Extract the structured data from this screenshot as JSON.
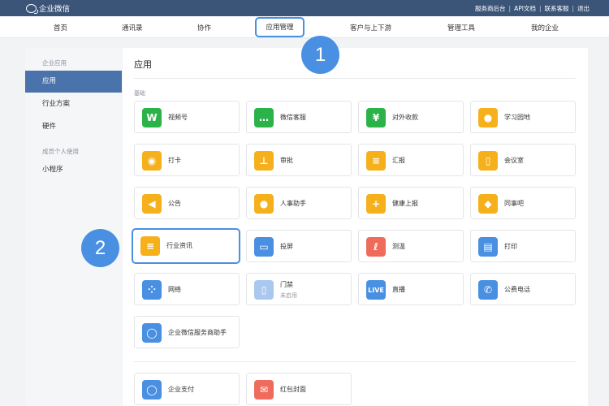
{
  "topbar": {
    "brand": "企业微信",
    "links": [
      "服务商后台",
      "API文档",
      "联系客服",
      "退出"
    ]
  },
  "nav": {
    "items": [
      "首页",
      "通讯录",
      "协作",
      "应用管理",
      "客户与上下游",
      "管理工具",
      "我的企业"
    ]
  },
  "sidebar": {
    "group1": "企业应用",
    "items1": [
      "应用",
      "行业方案",
      "硬件"
    ],
    "group2": "成员个人使用",
    "items2": [
      "小程序"
    ]
  },
  "main": {
    "title": "应用",
    "section": "基础",
    "apps": [
      {
        "label": "视频号",
        "color": "#2bb34a",
        "icon": "video-channel-icon"
      },
      {
        "label": "微信客服",
        "color": "#2bb34a",
        "icon": "wechat-service-icon"
      },
      {
        "label": "对外收款",
        "color": "#2bb34a",
        "icon": "payment-icon"
      },
      {
        "label": "学习园地",
        "color": "#f5b01b",
        "icon": "planet-icon"
      },
      {
        "label": "打卡",
        "color": "#f5b01b",
        "icon": "location-pin-icon"
      },
      {
        "label": "审批",
        "color": "#f5b01b",
        "icon": "stamp-icon"
      },
      {
        "label": "汇报",
        "color": "#f5b01b",
        "icon": "report-icon"
      },
      {
        "label": "会议室",
        "color": "#f5b01b",
        "icon": "door-icon"
      },
      {
        "label": "公告",
        "color": "#f5b01b",
        "icon": "megaphone-icon"
      },
      {
        "label": "人事助手",
        "color": "#f5b01b",
        "icon": "person-icon"
      },
      {
        "label": "健康上报",
        "color": "#f5b01b",
        "icon": "medical-kit-icon"
      },
      {
        "label": "同事吧",
        "color": "#f5b01b",
        "icon": "network-icon"
      },
      {
        "label": "行业资讯",
        "color": "#f5b01b",
        "icon": "news-icon"
      },
      {
        "label": "投屏",
        "color": "#4a90e2",
        "icon": "screen-cast-icon"
      },
      {
        "label": "测温",
        "color": "#ef6b5b",
        "icon": "thermometer-icon"
      },
      {
        "label": "打印",
        "color": "#4a90e2",
        "icon": "printer-icon"
      },
      {
        "label": "网络",
        "color": "#4a90e2",
        "icon": "router-icon"
      },
      {
        "label": "门禁",
        "sub": "未启用",
        "color": "#a9c8f0",
        "icon": "access-door-icon"
      },
      {
        "label": "直播",
        "color": "#4a90e2",
        "icon": "live-icon"
      },
      {
        "label": "公费电话",
        "color": "#4a90e2",
        "icon": "phone-icon"
      },
      {
        "label": "企业微信服务商助手",
        "color": "#4a90e2",
        "icon": "chat-bubble-icon"
      }
    ],
    "apps2": [
      {
        "label": "企业支付",
        "color": "#4a90e2",
        "icon": "payment-chat-icon"
      },
      {
        "label": "红包封面",
        "color": "#ef6b5b",
        "icon": "red-envelope-icon"
      }
    ]
  },
  "badges": {
    "one": "1",
    "two": "2"
  }
}
